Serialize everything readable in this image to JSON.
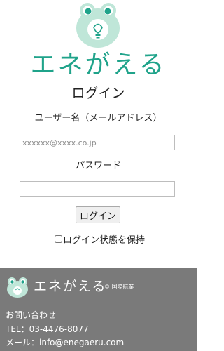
{
  "brand": {
    "name": "エネがえる",
    "logo_icon": "frog-lightbulb-icon"
  },
  "login": {
    "title": "ログイン",
    "username_label": "ユーザー名（メールアドレス）",
    "username_placeholder": "xxxxxx@xxxx.co.jp",
    "username_value": "",
    "password_label": "パスワード",
    "password_value": "",
    "submit_label": "ログイン",
    "remember_label": "ログイン状態を保持",
    "remember_checked": false
  },
  "footer": {
    "brand": "エネがえる",
    "copyright": "© 国際航業",
    "contact_heading": "お問い合わせ",
    "tel": "TEL：03-4476-8077",
    "email": "メール：info@enegaeru.com"
  },
  "colors": {
    "brand_green": "#1fa38a",
    "frog_face": "#bfe6d8",
    "footer_bg": "#7a7a7a"
  }
}
